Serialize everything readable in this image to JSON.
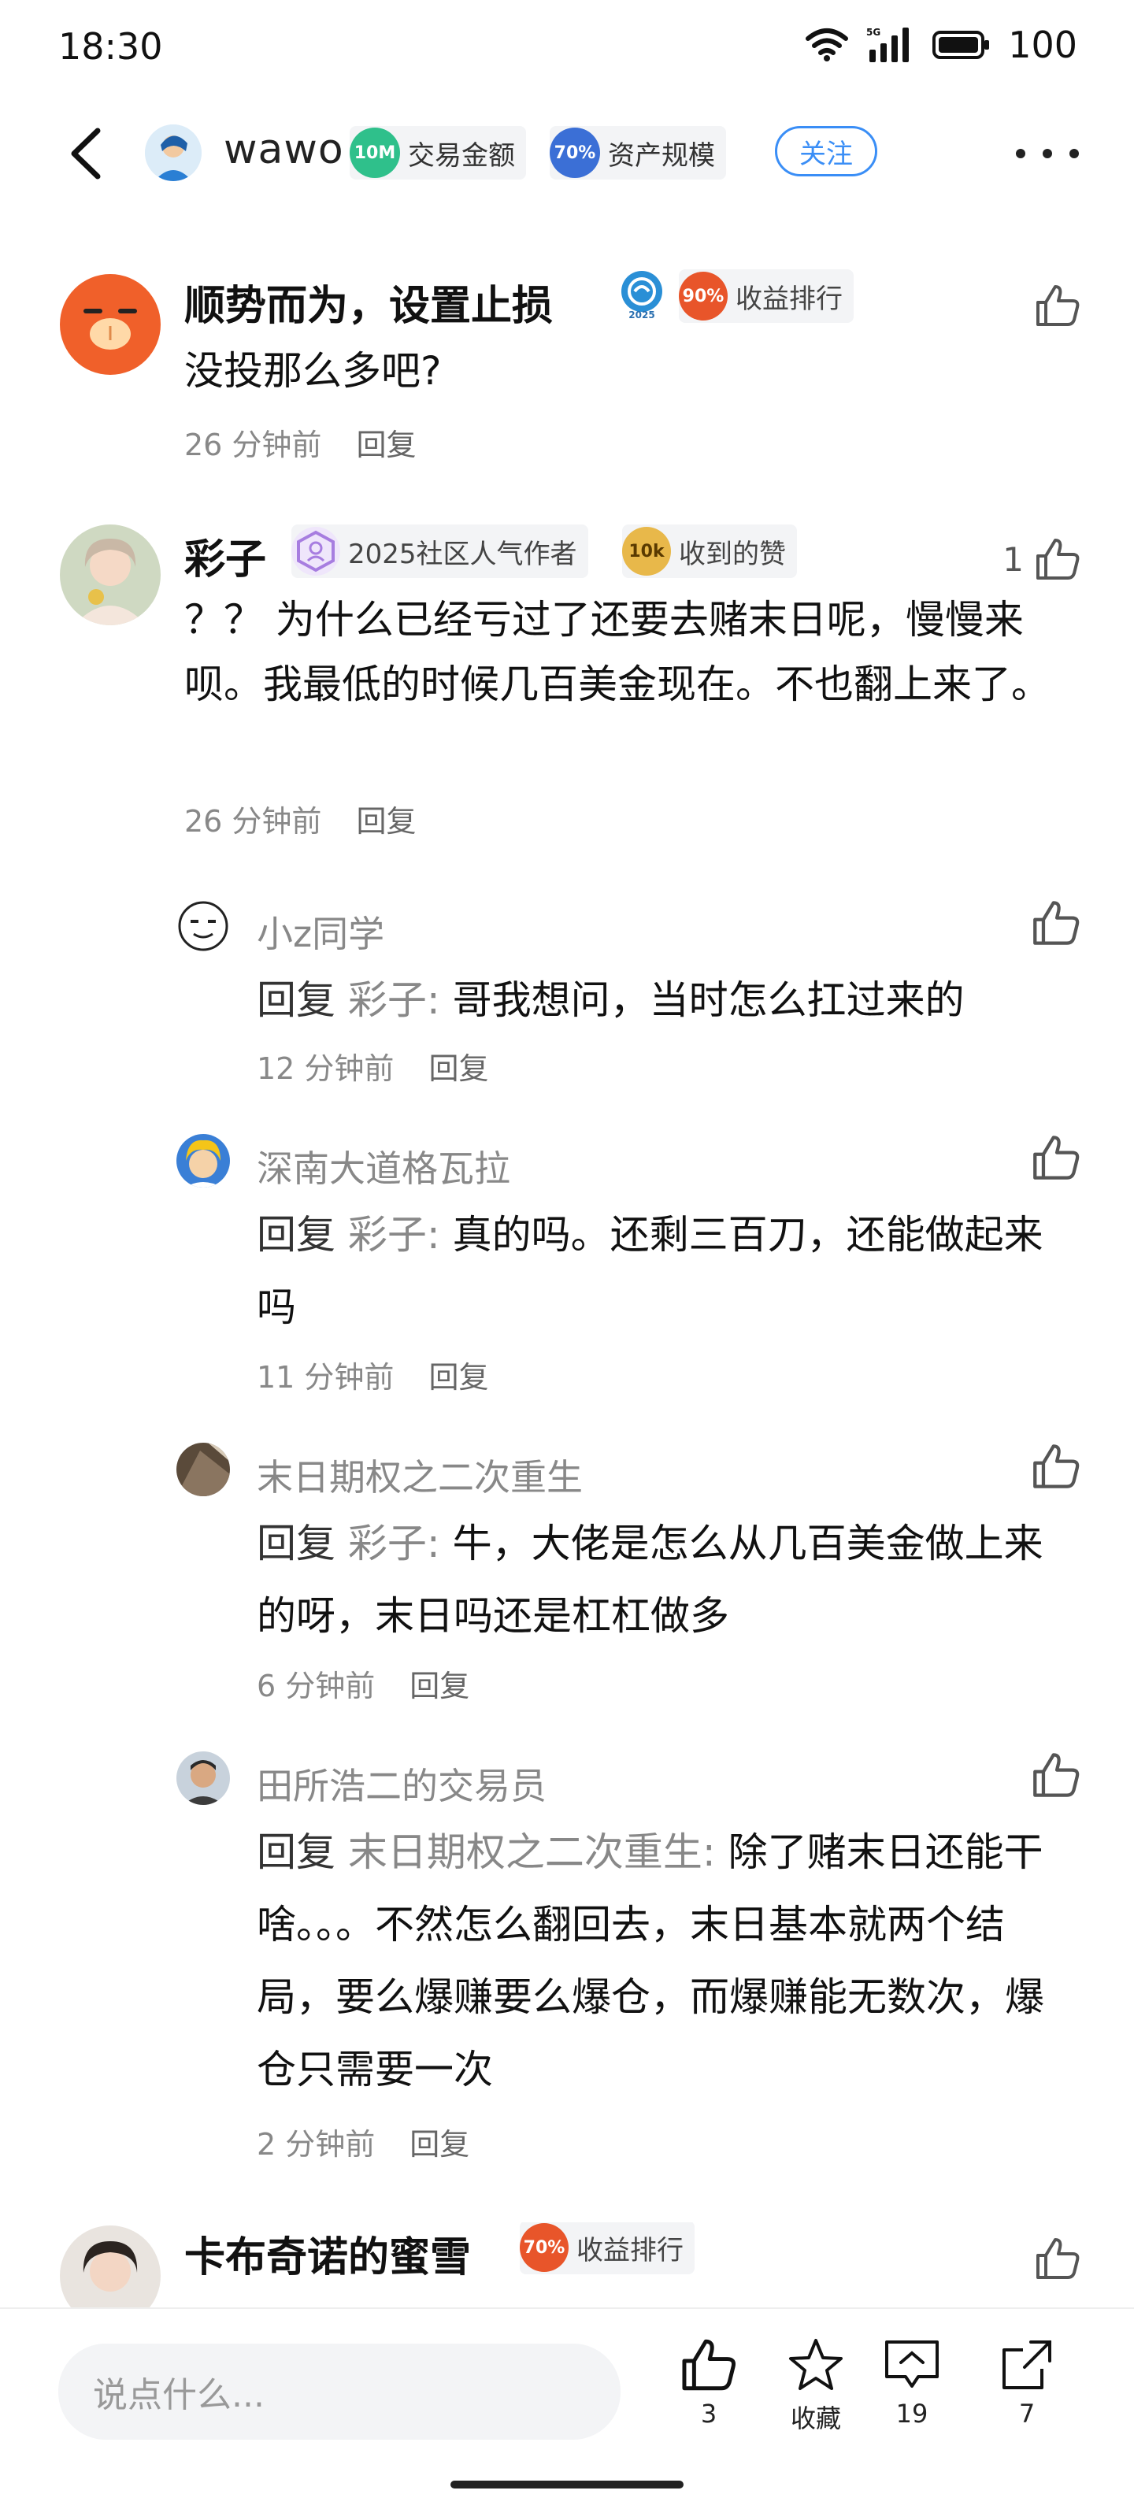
{
  "status": {
    "time": "18:30",
    "battery": "100",
    "network": "5G"
  },
  "nav": {
    "username": "wawo",
    "badges": [
      {
        "coin": "10M",
        "label": "交易金额",
        "color": "#2fc08b"
      },
      {
        "coin": "70%",
        "label": "资产规模",
        "color": "#3b6fd6"
      }
    ],
    "follow": "关注"
  },
  "comments": [
    {
      "name": "顺势而为，设置止损",
      "badge_coin": "90%",
      "badge_label": "收益排行",
      "text": "没投那么多吧?",
      "time": "26 分钟前",
      "reply": "回复",
      "likes": ""
    },
    {
      "name": "彩子",
      "badge1_label": "2025社区人气作者",
      "badge2_coin": "10k",
      "badge2_label": "收到的赞",
      "text": "？？ 为什么已经亏过了还要去赌末日呢，慢慢来呗。我最低的时候几百美金现在。不也翻上来了。",
      "time": "26 分钟前",
      "reply": "回复",
      "likes": "1"
    },
    {
      "name": "卡布奇诺的蜜雪",
      "badge_coin": "70%",
      "badge_label": "收益排行"
    }
  ],
  "replies": [
    {
      "name": "小z同学",
      "prefix": "回复 ",
      "target": "彩子:",
      "text": " 哥我想问，当时怎么扛过来的",
      "time": "12 分钟前",
      "reply": "回复"
    },
    {
      "name": "深南大道格瓦拉",
      "prefix": "回复 ",
      "target": "彩子:",
      "text": " 真的吗。还剩三百刀，还能做起来吗",
      "time": "11 分钟前",
      "reply": "回复"
    },
    {
      "name": "末日期权之二次重生",
      "prefix": "回复 ",
      "target": "彩子:",
      "text": " 牛，大佬是怎么从几百美金做上来的呀，末日吗还是杠杠做多",
      "time": "6 分钟前",
      "reply": "回复"
    },
    {
      "name": "田所浩二的交易员",
      "prefix": "回复 ",
      "target": "末日期权之二次重生:",
      "text": " 除了赌末日还能干啥。。。不然怎么翻回去，末日基本就两个结局，要么爆赚要么爆仓，而爆赚能无数次，爆仓只需要一次",
      "time": "2 分钟前",
      "reply": "回复"
    }
  ],
  "bottom": {
    "placeholder": "说点什么...",
    "like_count": "3",
    "favorite_label": "收藏",
    "comment_count": "19",
    "share_count": "7"
  },
  "colors": {
    "accent": "#3a8ef6",
    "badge_orange": "#e8552a",
    "badge_gold": "#e8b84a"
  }
}
